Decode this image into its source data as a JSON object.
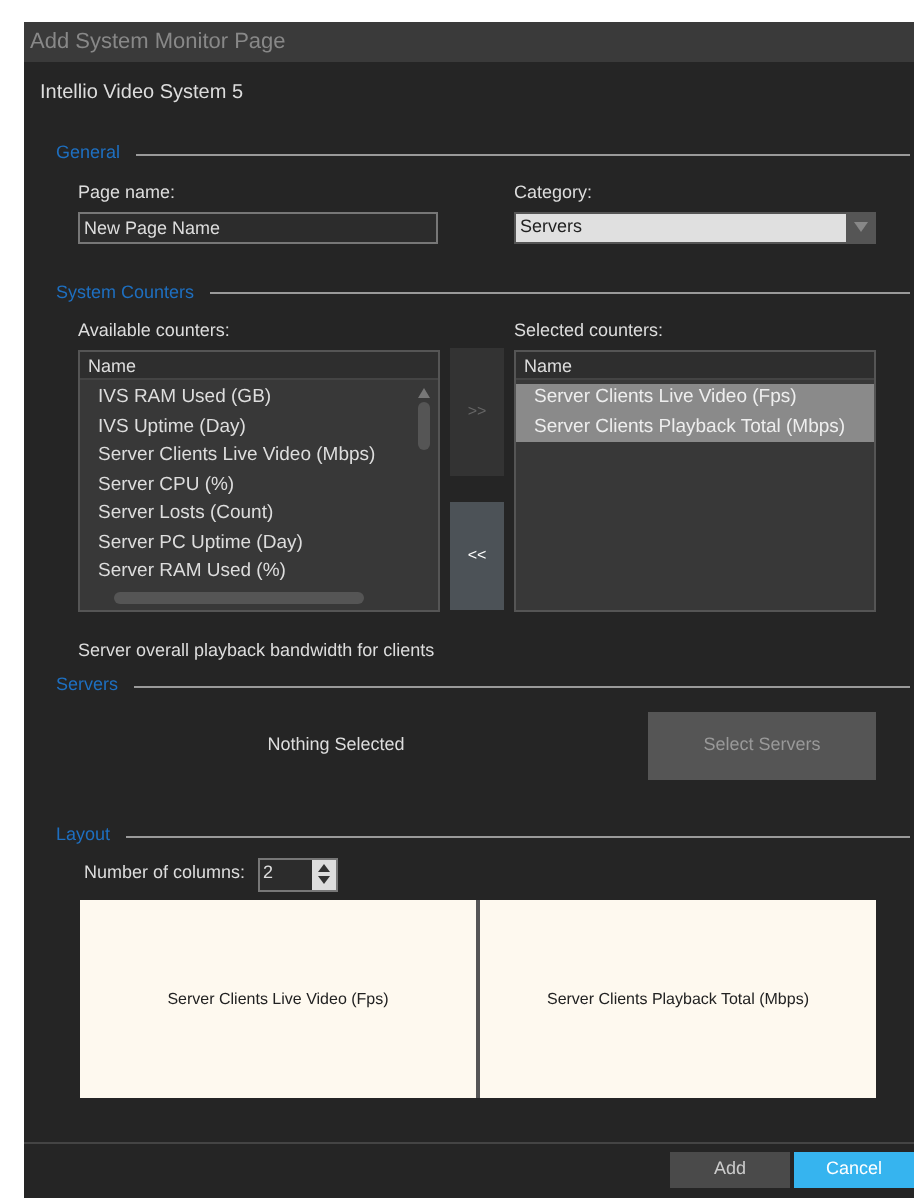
{
  "window": {
    "title": "Add System Monitor Page"
  },
  "subtitle": "Intellio Video System 5",
  "general": {
    "title": "General",
    "page_name_label": "Page name:",
    "page_name_value": "New Page Name",
    "category_label": "Category:",
    "category_value": "Servers"
  },
  "counters": {
    "title": "System Counters",
    "available_label": "Available counters:",
    "selected_label": "Selected counters:",
    "available": {
      "column": "Name",
      "items": [
        {
          "name": "IVS RAM Used (GB)",
          "selected": false
        },
        {
          "name": "IVS Uptime (Day)",
          "selected": false
        },
        {
          "name": "Server Clients Live Video (Mbps)",
          "selected": false
        },
        {
          "name": "Server CPU (%)",
          "selected": false
        },
        {
          "name": "Server Losts (Count)",
          "selected": false
        },
        {
          "name": "Server PC Uptime (Day)",
          "selected": false
        },
        {
          "name": "Server RAM Used (%)",
          "selected": false
        }
      ]
    },
    "add_button": {
      "label": ">>",
      "disabled": true
    },
    "remove_button": {
      "label": "<<",
      "disabled": false
    },
    "selected": {
      "column": "Name",
      "items": [
        {
          "name": "Server Clients Live Video (Fps)",
          "selected": true
        },
        {
          "name": "Server Clients Playback Total (Mbps)",
          "selected": true
        }
      ]
    },
    "description": "Server overall playback bandwidth for clients"
  },
  "servers": {
    "title": "Servers",
    "status": "Nothing Selected",
    "button": "Select Servers"
  },
  "layout": {
    "title": "Layout",
    "columns_label": "Number of columns:",
    "columns_value": "2",
    "cells": [
      "Server Clients Live Video (Fps)",
      "Server Clients Playback Total (Mbps)"
    ]
  },
  "buttons": [
    {
      "label": "Add",
      "kind": "primary"
    },
    {
      "label": "Cancel",
      "kind": "accent"
    }
  ]
}
